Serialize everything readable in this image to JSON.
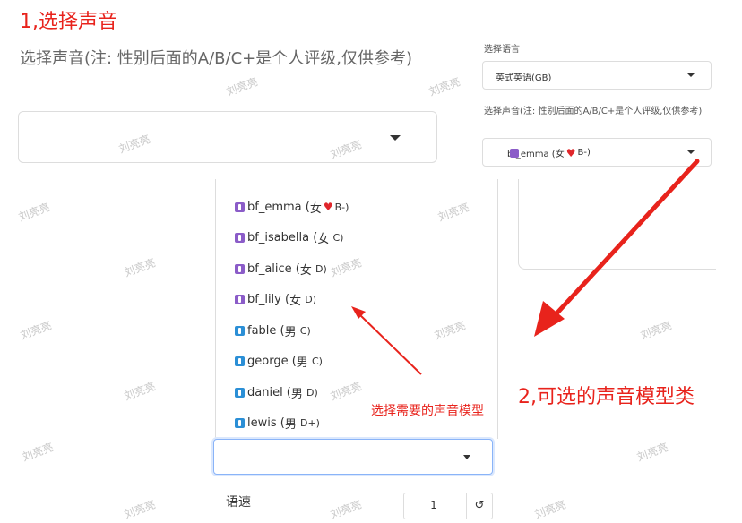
{
  "annotations": {
    "step1": "1,选择声音",
    "step2": "2,可选的声音模型类",
    "pick": "选择需要的声音模型"
  },
  "left_form": {
    "voice_label": "选择声音(注: 性别后面的A/B/C+是个人评级,仅供参考)",
    "voice_value": ""
  },
  "right_panel": {
    "language_label": "选择语言",
    "language_value": "英式英语(GB)",
    "voice_label": "选择声音(注: 性别后面的A/B/C+是个人评级,仅供参考)",
    "voice_value_name": "bf_emma (女",
    "voice_value_grade": "B-)"
  },
  "voice_options": [
    {
      "name": "bf_emma",
      "gender": "女",
      "grade": "B-)",
      "heart": true,
      "type": "female"
    },
    {
      "name": "bf_isabella",
      "gender": "女",
      "grade": "C)",
      "heart": false,
      "type": "female"
    },
    {
      "name": "bf_alice",
      "gender": "女",
      "grade": "D)",
      "heart": false,
      "type": "female"
    },
    {
      "name": "bf_lily",
      "gender": "女",
      "grade": "D)",
      "heart": false,
      "type": "female"
    },
    {
      "name": "fable",
      "gender": "男",
      "grade": "C)",
      "heart": false,
      "type": "male"
    },
    {
      "name": "george",
      "gender": "男",
      "grade": "C)",
      "heart": false,
      "type": "male"
    },
    {
      "name": "daniel",
      "gender": "男",
      "grade": "D)",
      "heart": false,
      "type": "male"
    },
    {
      "name": "lewis",
      "gender": "男",
      "grade": "D+)",
      "heart": false,
      "type": "male"
    }
  ],
  "speed": {
    "label": "语速",
    "value": "1",
    "reset_glyph": "↺"
  },
  "watermark": "刘亮亮",
  "colors": {
    "annotation_red": "#e8231c",
    "female_badge": "#8b5cc8",
    "male_badge": "#2b8fd6",
    "heart": "#e0262b"
  }
}
